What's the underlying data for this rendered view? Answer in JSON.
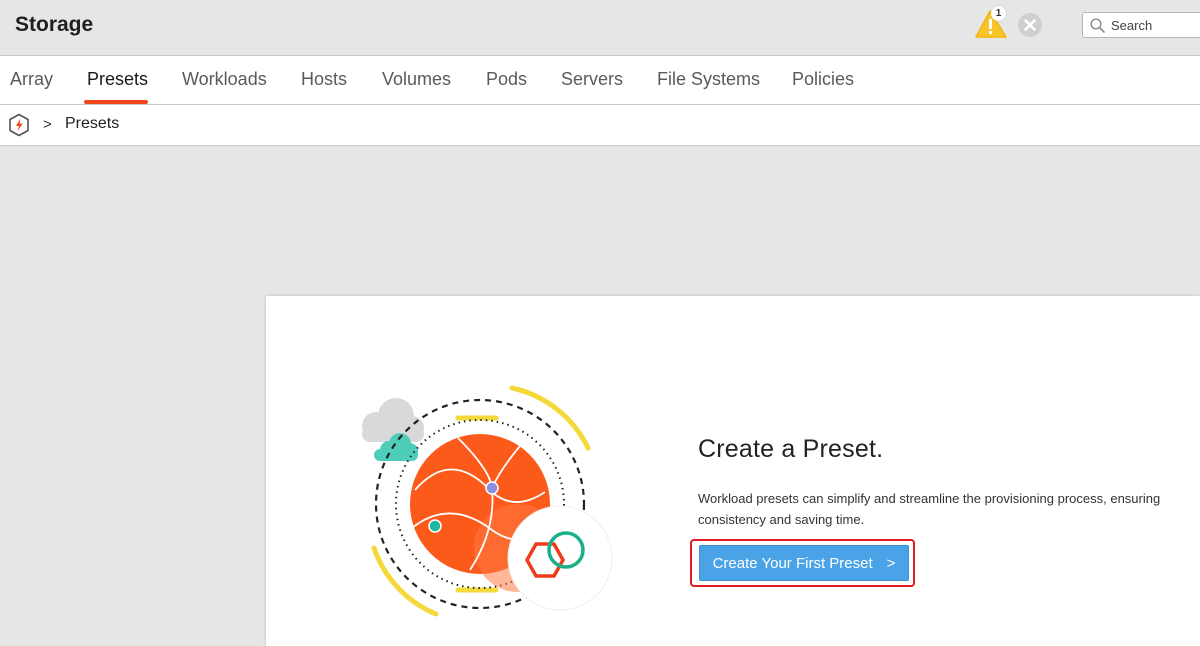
{
  "header": {
    "title": "Storage",
    "alert_count": "1",
    "search": {
      "placeholder": "Search"
    }
  },
  "tabs": [
    {
      "label": "Array"
    },
    {
      "label": "Presets",
      "active": true
    },
    {
      "label": "Workloads"
    },
    {
      "label": "Hosts"
    },
    {
      "label": "Volumes"
    },
    {
      "label": "Pods"
    },
    {
      "label": "Servers"
    },
    {
      "label": "File Systems"
    },
    {
      "label": "Policies"
    }
  ],
  "breadcrumb": {
    "home_icon": "purestorage-logo-icon",
    "separator": ">",
    "current": "Presets"
  },
  "empty_state": {
    "title": "Create a Preset.",
    "description": "Workload presets can simplify and streamline the provisioning process, ensuring consistency and saving time.",
    "button_label": "Create Your First Preset",
    "button_chevron": ">"
  },
  "colors": {
    "accent": "#f0461c",
    "button": "#4aa3e6",
    "highlight": "#e01b24",
    "alert": "#f7c52b"
  }
}
